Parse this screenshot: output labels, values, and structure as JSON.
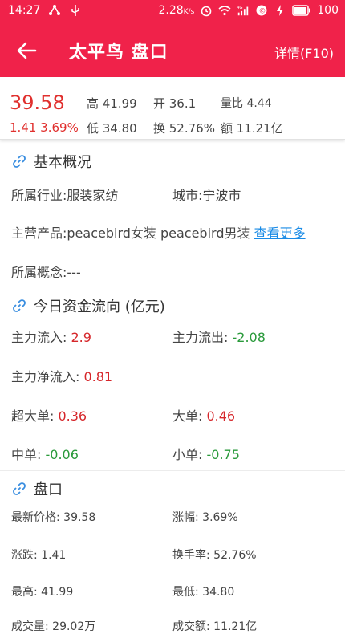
{
  "status": {
    "time": "14:27",
    "speed": "2.28",
    "speed_unit": "K/s",
    "battery": "100",
    "signal": "4G"
  },
  "header": {
    "title": "太平鸟 盘口",
    "detail": "详情(F10)"
  },
  "quote": {
    "price": "39.58",
    "change": "1.41 3.69%",
    "high": "高 41.99",
    "open": "开 36.1",
    "vol_ratio": "量比 4.44",
    "low": "低 34.80",
    "turnover": "换 52.76%",
    "amount": "额 11.21亿"
  },
  "overview": {
    "title": "基本概况",
    "industry": "所属行业:服装家纺",
    "city": "城市:宁波市",
    "products": "主营产品:peacebird女装 peacebird男装",
    "more": "查看更多",
    "concept": "所属概念:---"
  },
  "flow": {
    "title": "今日资金流向 (亿元)",
    "in_label": "主力流入: ",
    "in_value": "2.9",
    "out_label": "主力流出: ",
    "out_value": "-2.08",
    "net_label": "主力净流入: ",
    "net_value": "0.81",
    "xl_label": "超大单: ",
    "xl_value": "0.36",
    "l_label": "大单: ",
    "l_value": "0.46",
    "m_label": "中单: ",
    "m_value": "-0.06",
    "s_label": "小单: ",
    "s_value": "-0.75"
  },
  "panel": {
    "title": "盘口",
    "latest": "最新价格: 39.58",
    "pct": "涨幅: 3.69%",
    "change": "涨跌: 1.41",
    "turnover": "换手率: 52.76%",
    "high": "最高: 41.99",
    "low": "最低: 34.80",
    "volume": "成交量: 29.02万",
    "amount": "成交额: 11.21亿"
  },
  "colors": {
    "brand": "#f0224a",
    "up": "#d6272b",
    "down": "#2a9a3b",
    "link": "#1a8be6"
  }
}
